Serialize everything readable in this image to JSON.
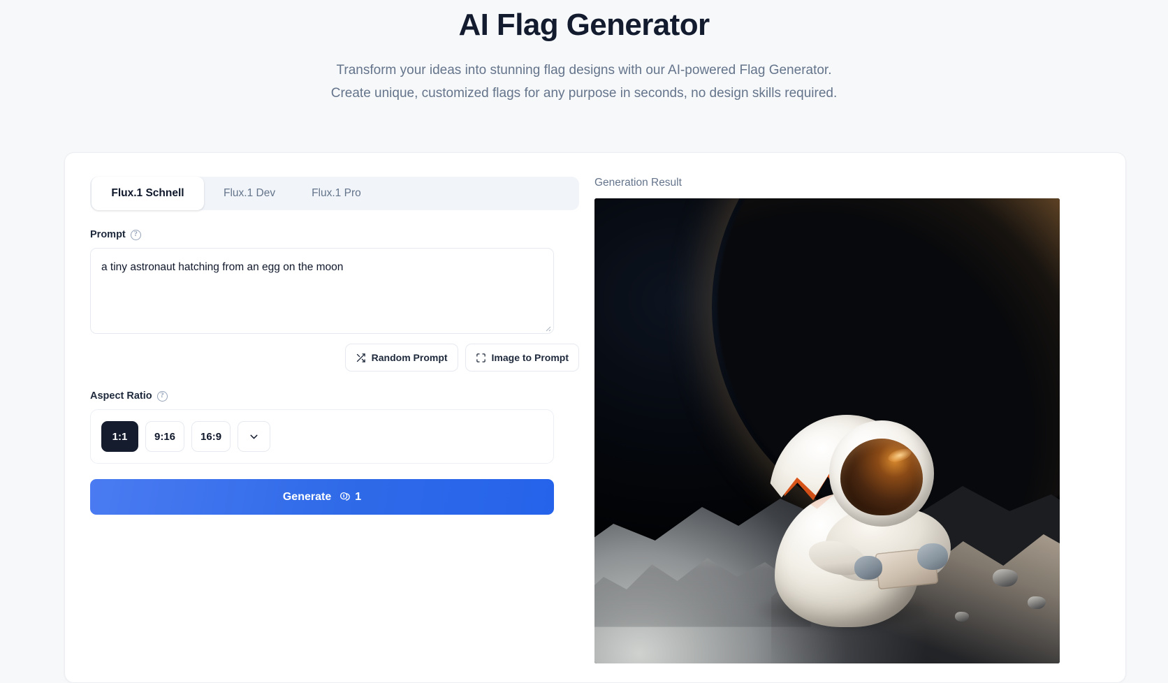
{
  "hero": {
    "title": "AI Flag Generator",
    "subtitle_line1": "Transform your ideas into stunning flag designs with our AI-powered Flag Generator.",
    "subtitle_line2": "Create unique, customized flags for any purpose in seconds, no design skills required."
  },
  "tabs": [
    {
      "label": "Flux.1 Schnell",
      "active": true
    },
    {
      "label": "Flux.1 Dev",
      "active": false
    },
    {
      "label": "Flux.1 Pro",
      "active": false
    }
  ],
  "prompt": {
    "label": "Prompt",
    "help": "?",
    "value": "a tiny astronaut hatching from an egg on the moon",
    "placeholder": "a tiny astronaut hatching from an egg on the moon"
  },
  "prompt_actions": {
    "random_prompt": "Random Prompt",
    "image_to_prompt": "Image to Prompt"
  },
  "aspect_ratio": {
    "label": "Aspect Ratio",
    "help": "?",
    "options": [
      "1:1",
      "9:16",
      "16:9"
    ],
    "selected": "1:1",
    "more_label": "More aspect ratios"
  },
  "generate": {
    "label": "Generate",
    "credits": "1"
  },
  "result": {
    "label": "Generation Result",
    "image_alt": "a tiny astronaut hatching from an egg on the moon"
  },
  "colors": {
    "page_background": "#f7f8fa",
    "card_background": "#ffffff",
    "title": "#131b2e",
    "muted_text": "#64748b",
    "tab_strip": "#f1f4f9",
    "accent_primary": "#2563eb",
    "selected_dark": "#141c2e",
    "border": "#e6eaf0"
  }
}
